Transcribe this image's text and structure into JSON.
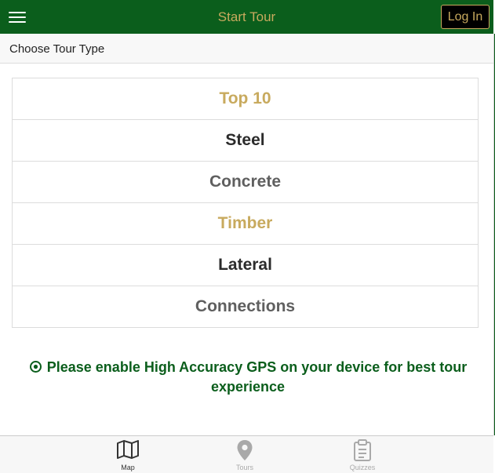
{
  "header": {
    "title": "Start Tour",
    "login_label": "Log In"
  },
  "subheader": {
    "title": "Choose Tour Type"
  },
  "tours": [
    {
      "label": "Top 10"
    },
    {
      "label": "Steel"
    },
    {
      "label": "Concrete"
    },
    {
      "label": "Timber"
    },
    {
      "label": "Lateral"
    },
    {
      "label": "Connections"
    }
  ],
  "gps_notice": {
    "text": "Please enable High Accuracy GPS on your device for best tour experience",
    "icon": "target-icon"
  },
  "tabbar": {
    "tabs": [
      {
        "label": "Map",
        "icon": "map-icon",
        "active": true
      },
      {
        "label": "Tours",
        "icon": "location-pin-icon",
        "active": false
      },
      {
        "label": "Quizzes",
        "icon": "clipboard-icon",
        "active": false
      }
    ]
  },
  "colors": {
    "primary_green": "#0b5e1c",
    "accent_gold": "#c8aa5e",
    "text_dark": "#2b2b2b",
    "text_gray": "#5f5f5f"
  }
}
